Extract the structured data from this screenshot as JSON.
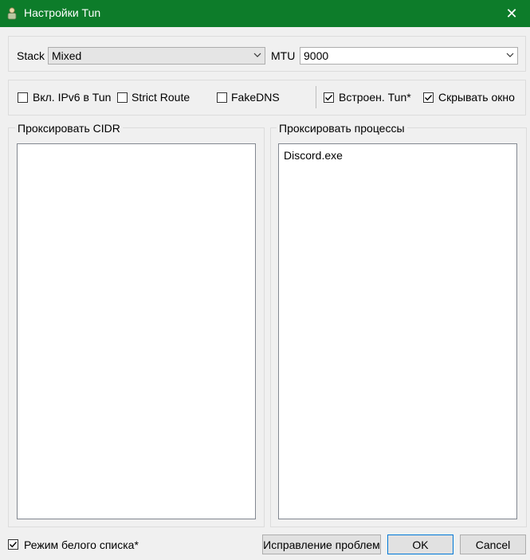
{
  "window": {
    "title": "Настройки Tun",
    "close_glyph": "✕"
  },
  "stack": {
    "label": "Stack",
    "value": "Mixed"
  },
  "mtu": {
    "label": "MTU",
    "value": "9000"
  },
  "options": {
    "ipv6": {
      "label": "Вкл. IPv6 в Tun",
      "checked": false
    },
    "strict_route": {
      "label": "Strict Route",
      "checked": false
    },
    "fakedns": {
      "label": "FakeDNS",
      "checked": false
    },
    "builtin_tun": {
      "label": "Встроен. Tun*",
      "checked": true
    },
    "hide_window": {
      "label": "Скрывать окно",
      "checked": true
    }
  },
  "proxy_cidr": {
    "title": "Проксировать CIDR",
    "lines": [
      ""
    ]
  },
  "proxy_processes": {
    "title": "Проксировать процессы",
    "lines": [
      "Discord.exe"
    ]
  },
  "whitelist_mode": {
    "label": "Режим белого списка*",
    "checked": true
  },
  "buttons": {
    "fix": "Исправление проблем",
    "ok": "OK",
    "cancel": "Cancel"
  }
}
